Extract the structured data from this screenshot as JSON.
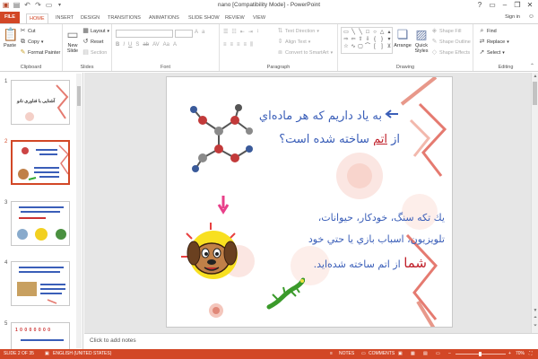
{
  "window": {
    "title": "nano [Compatibility Mode] - PowerPoint",
    "minimize_icon": "minimize-icon",
    "maximize_icon": "restore-icon",
    "close_icon": "close-icon",
    "help_icon": "help-icon"
  },
  "qat": {
    "icons": [
      "powerpoint-logo-icon",
      "save-icon",
      "undo-icon",
      "redo-icon",
      "start-slideshow-icon",
      "customize-qat-icon"
    ]
  },
  "tabs": [
    "FILE",
    "HOME",
    "INSERT",
    "DESIGN",
    "TRANSITIONS",
    "ANIMATIONS",
    "SLIDE SHOW",
    "REVIEW",
    "VIEW"
  ],
  "signin": "Sign in",
  "ribbon": {
    "clipboard": {
      "label": "Clipboard",
      "paste": "Paste",
      "cut": "Cut",
      "copy": "Copy",
      "format_painter": "Format Painter"
    },
    "slides": {
      "label": "Slides",
      "new_slide": "New Slide",
      "layout": "Layout",
      "reset": "Reset",
      "section": "Section"
    },
    "font": {
      "label": "Font"
    },
    "paragraph": {
      "label": "Paragraph",
      "text_direction": "Text Direction",
      "align_text": "Align Text",
      "convert_smartart": "Convert to SmartArt"
    },
    "drawing": {
      "label": "Drawing",
      "arrange": "Arrange",
      "quick_styles": "Quick Styles",
      "shape_fill": "Shape Fill",
      "shape_outline": "Shape Outline",
      "shape_effects": "Shape Effects"
    },
    "editing": {
      "label": "Editing",
      "find": "Find",
      "replace": "Replace",
      "select": "Select"
    }
  },
  "thumbnails": [
    {
      "num": "1",
      "selected": false
    },
    {
      "num": "2",
      "selected": true
    },
    {
      "num": "3",
      "selected": false
    },
    {
      "num": "4",
      "selected": false
    },
    {
      "num": "5",
      "selected": false
    }
  ],
  "thumb_text": {
    "t1": "آشنایی با فناوری نانو",
    "t5": "1 0 0 0 0 0 0 0"
  },
  "slide": {
    "line1": "به ياد داريم كه هر ماده‌اي",
    "line2_pre": "از ",
    "line2_atom": "اتم",
    "line2_post": " ساخته شده است؟",
    "line3": "يك تكه سنگ، خودكار، حيوانات،",
    "line4": "تلويزيون، اسباب بازي يا حتي خود",
    "line5_shoma": "شما",
    "line5_post": " از اتم ساخته شده‌ايد."
  },
  "notes_placeholder": "Click to add notes",
  "status": {
    "slide_count": "SLIDE 2 OF 35",
    "language": "ENGLISH (UNITED STATES)",
    "notes": "NOTES",
    "comments": "COMMENTS",
    "zoom": "70%"
  },
  "colors": {
    "accent": "#d24726",
    "text_blue": "#3a5eb8",
    "text_red": "#c0202a"
  }
}
